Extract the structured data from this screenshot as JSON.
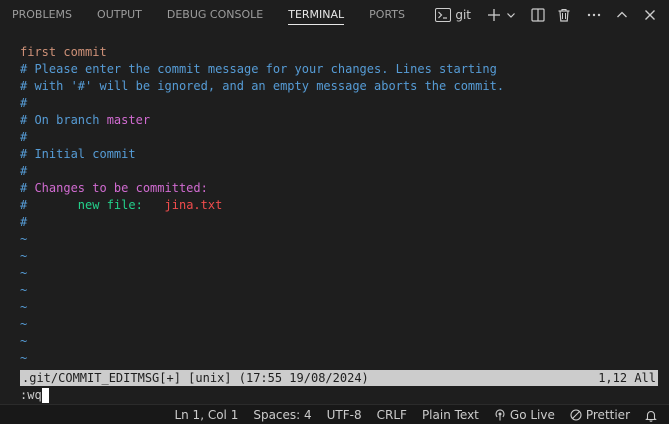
{
  "panel": {
    "tabs": [
      {
        "label": "PROBLEMS"
      },
      {
        "label": "OUTPUT"
      },
      {
        "label": "DEBUG CONSOLE"
      },
      {
        "label": "TERMINAL"
      },
      {
        "label": "PORTS"
      }
    ],
    "active_tab": "TERMINAL",
    "terminal_name": "git"
  },
  "terminal": {
    "lines": [
      {
        "text": "first commit",
        "color": "#ce9178"
      },
      {
        "text": "# Please enter the commit message for your changes. Lines starting"
      },
      {
        "text": "# with '#' will be ignored, and an empty message aborts the commit."
      },
      {
        "text": "#"
      },
      {
        "prefix": "# On branch ",
        "value": "master"
      },
      {
        "text": "#"
      },
      {
        "text": "# Initial commit"
      },
      {
        "text": "#"
      },
      {
        "prefix": "# ",
        "value": "Changes to be committed:"
      },
      {
        "prefix": "#       ",
        "label": "new file:",
        "value": "jina.txt"
      },
      {
        "text": "#"
      }
    ],
    "tildes": [
      "~",
      "~",
      "~",
      "~",
      "~",
      "~",
      "~",
      "~"
    ],
    "vim_status_left": ".git/COMMIT_EDITMSG[+] [unix] (17:55 19/08/2024)",
    "vim_status_right": "1,12 All",
    "command": ":wq"
  },
  "statusbar": {
    "position": "Ln 1, Col 1",
    "spaces": "Spaces: 4",
    "encoding": "UTF-8",
    "eol": "CRLF",
    "language": "Plain Text",
    "go_live": "Go Live",
    "prettier": "Prettier"
  },
  "colors": {
    "comment": "#569cd6",
    "message": "#ce9178",
    "branch": "#d16bd1",
    "new_file_label": "#23d18b",
    "filename": "#f14c4c"
  }
}
